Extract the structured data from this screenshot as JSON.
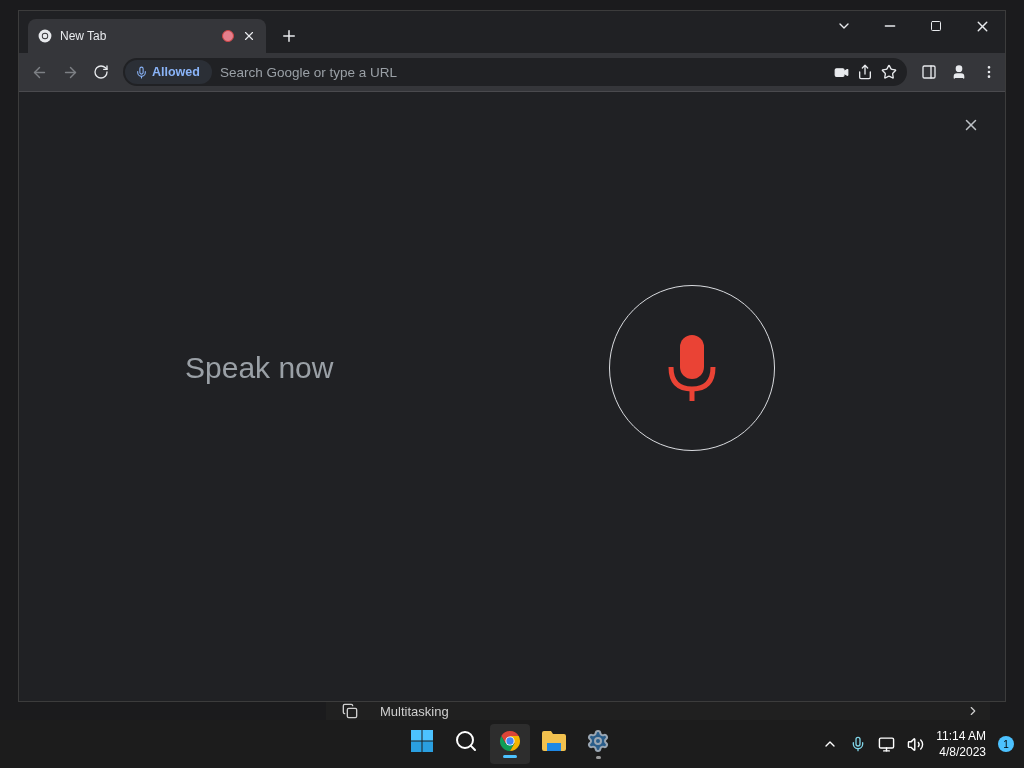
{
  "browser": {
    "tabs": [
      {
        "title": "New Tab",
        "recording": true,
        "selected": true
      }
    ],
    "address_bar": {
      "permission_chip": "Allowed",
      "placeholder": "Search Google or type a URL"
    },
    "voice_search": {
      "prompt": "Speak now"
    }
  },
  "background_window": {
    "item_title": "Multitasking"
  },
  "taskbar": {
    "apps": [
      {
        "kind": "start",
        "active": false,
        "running": false
      },
      {
        "kind": "search",
        "active": false,
        "running": false
      },
      {
        "kind": "chrome",
        "active": true,
        "running": true
      },
      {
        "kind": "files",
        "active": false,
        "running": false
      },
      {
        "kind": "settings",
        "active": false,
        "running": true
      }
    ],
    "time": "11:14 AM",
    "date": "4/8/2023",
    "notification_count": "1"
  }
}
